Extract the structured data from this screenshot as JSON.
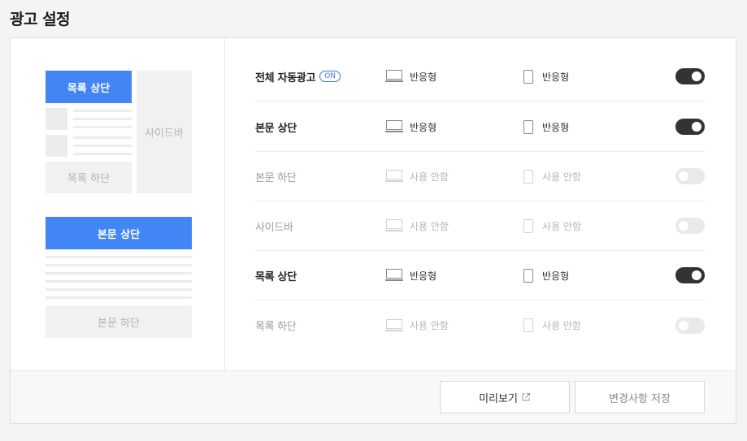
{
  "page": {
    "title": "광고 설정"
  },
  "preview": {
    "list_top": "목록 상단",
    "sidebar": "사이드바",
    "list_bottom": "목록 하단",
    "body_top": "본문 상단",
    "body_bottom": "본문 하단"
  },
  "settings": {
    "rows": [
      {
        "label": "전체 자동광고",
        "badge": "ON",
        "pc": "반응형",
        "mobile": "반응형",
        "enabled": true
      },
      {
        "label": "본문 상단",
        "pc": "반응형",
        "mobile": "반응형",
        "enabled": true
      },
      {
        "label": "본문 하단",
        "pc": "사용 안함",
        "mobile": "사용 안함",
        "enabled": false
      },
      {
        "label": "사이드바",
        "pc": "사용 안함",
        "mobile": "사용 안함",
        "enabled": false
      },
      {
        "label": "목록 상단",
        "pc": "반응형",
        "mobile": "반응형",
        "enabled": true
      },
      {
        "label": "목록 하단",
        "pc": "사용 안함",
        "mobile": "사용 안함",
        "enabled": false
      }
    ]
  },
  "footer": {
    "preview_label": "미리보기",
    "save_label": "변경사항 저장"
  },
  "icons": {
    "pc": "desktop-icon",
    "mobile": "mobile-icon",
    "external": "external-link-icon"
  },
  "colors": {
    "accent": "#4285f4",
    "toggle_on": "#333333",
    "toggle_off": "#e9e9e9"
  }
}
